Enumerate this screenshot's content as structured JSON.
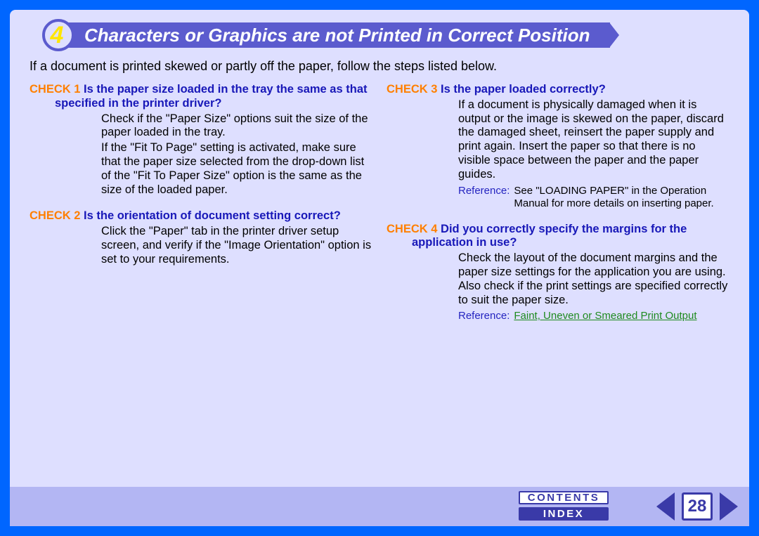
{
  "header": {
    "section_number": "4",
    "title": "Characters or Graphics are not Printed in Correct Position"
  },
  "intro": "If a document is printed skewed or partly off the paper, follow the steps listed below.",
  "checks": {
    "c1": {
      "label": "CHECK 1",
      "question": "Is the paper size loaded in the tray the same as that specified in the printer driver?",
      "body1": "Check if the \"Paper Size\" options suit the size of the paper loaded in the tray.",
      "body2": "If the \"Fit To Page\" setting is activated, make sure that the paper size selected from the drop-down list of the \"Fit To Paper Size\" option is the same as the size of the loaded paper."
    },
    "c2": {
      "label": "CHECK 2",
      "question": "Is the orientation of document setting correct?",
      "body1": "Click the \"Paper\" tab in the printer driver setup screen, and verify if the \"Image Orientation\" option is set to your requirements."
    },
    "c3": {
      "label": "CHECK 3",
      "question": "Is the paper loaded correctly?",
      "body1": "If a document is physically damaged when it is output or the image is skewed on the paper, discard the damaged sheet, reinsert the paper supply and print again. Insert the paper so that there is no visible space between the paper and the paper guides.",
      "ref_label": "Reference:",
      "ref_text": "See \"LOADING PAPER\" in the Operation Manual for more details on inserting paper."
    },
    "c4": {
      "label": "CHECK 4",
      "question": "Did you correctly specify the margins for the application in use?",
      "body1": "Check the layout of the document margins and the paper size settings for the application you are using. Also check if the print settings are specified correctly to suit the paper size.",
      "ref_label": "Reference:",
      "ref_link": "Faint, Uneven or Smeared Print Output"
    }
  },
  "footer": {
    "contents_label": "CONTENTS",
    "index_label": "INDEX",
    "page_number": "28"
  }
}
